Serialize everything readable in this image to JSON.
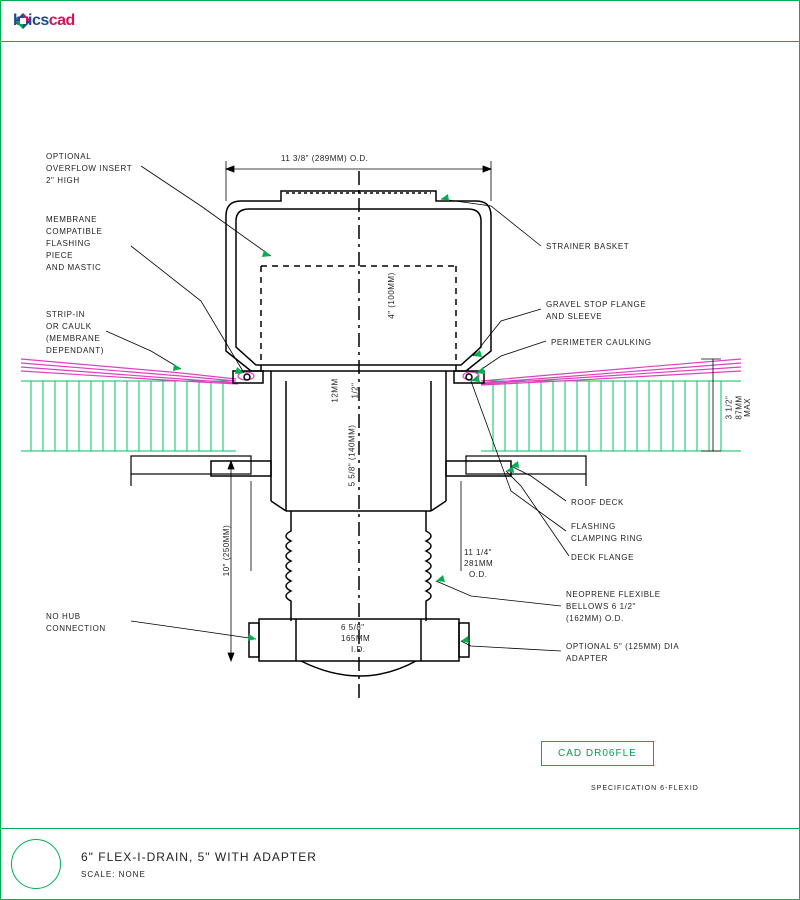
{
  "header": {
    "logo_left": "brics",
    "logo_right": "cad"
  },
  "footer": {
    "title": "6\" FLEX-I-DRAIN, 5\" WITH ADAPTER",
    "scale": "SCALE: NONE"
  },
  "cad_box": "CAD DR06FLE",
  "spec": "SPECIFICATION 6-FLEXID",
  "dims": {
    "top_od": "11 3/8\" (289MM) O.D.",
    "four_in": "4\"  (100MM)",
    "half_in": "1/2\"",
    "twelve_mm": "12MM",
    "five_five_eight": "5 5/8\"  (140MM)",
    "ten_in": "10\"  (250MM)",
    "six_five_eight": "6 5/8\"",
    "one_sixty_five": "165MM",
    "id": "I.D.",
    "eleven_quarter": "11 1/4\"",
    "two_eighty_one": "281MM",
    "od": "O.D.",
    "three_half": "3 1/2\"",
    "eighty_seven": "87MM",
    "max": "MAX"
  },
  "labels": {
    "overflow": "OPTIONAL\nOVERFLOW INSERT\n2\" HIGH",
    "membrane": "MEMBRANE\nCOMPATIBLE\nFLASHING\nPIECE\nAND MASTIC",
    "strip": "STRIP-IN\nOR CAULK\n(MEMBRANE\nDEPENDANT)",
    "nohub": "NO HUB\nCONNECTION",
    "strainer": "STRAINER BASKET",
    "gravel": "GRAVEL STOP FLANGE\nAND SLEEVE",
    "perimeter": "PERIMETER CAULKING",
    "roofdeck": "ROOF DECK",
    "flashing": "FLASHING\nCLAMPING RING",
    "deckflange": "DECK FLANGE",
    "neoprene": "NEOPRENE FLEXIBLE\nBELLOWS 6 1/2\"\n(162MM) O.D.",
    "adapter": "OPTIONAL 5\" (125MM) DIA\nADAPTER"
  }
}
